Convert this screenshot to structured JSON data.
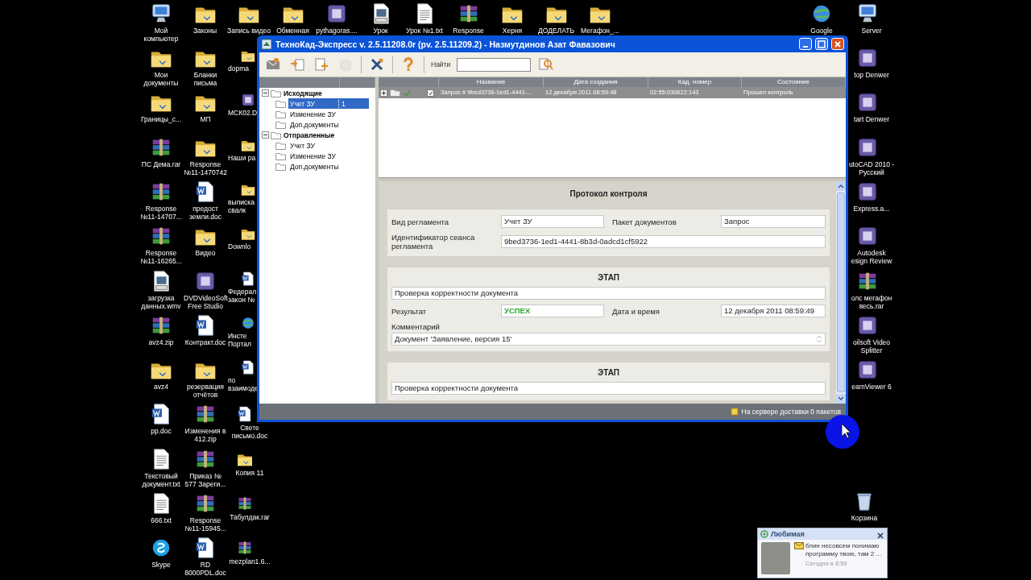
{
  "desktop": {
    "top_row": [
      {
        "label": "Мой компьютер",
        "kind": "computer"
      },
      {
        "label": "Законы",
        "kind": "folder"
      },
      {
        "label": "Запись видео",
        "kind": "folder"
      },
      {
        "label": "Обменная",
        "kind": "folder"
      },
      {
        "label": "pythagoras....",
        "kind": "app"
      },
      {
        "label": "Урок",
        "kind": "video"
      },
      {
        "label": "Урок №1.txt",
        "kind": "text"
      },
      {
        "label": "Response",
        "kind": "archive"
      },
      {
        "label": "Херня",
        "kind": "folder"
      },
      {
        "label": "ДОДЕЛАТЬ",
        "kind": "folder"
      },
      {
        "label": "Мегафон_...",
        "kind": "folder"
      }
    ],
    "column_1": [
      {
        "label": "Мои документы",
        "kind": "folder"
      },
      {
        "label": "Границы_с...",
        "kind": "folder"
      },
      {
        "label": "ПС Дема.rar",
        "kind": "archive"
      },
      {
        "label": "Response №11-14707...",
        "kind": "archive"
      },
      {
        "label": "Response №11-16265...",
        "kind": "archive"
      },
      {
        "label": "загрузка данных.wmv",
        "kind": "video"
      },
      {
        "label": "avz4.zip",
        "kind": "archive"
      },
      {
        "label": "avz4",
        "kind": "folder"
      },
      {
        "label": "pp.doc",
        "kind": "word"
      },
      {
        "label": "Текстовый документ.txt",
        "kind": "text"
      },
      {
        "label": "666.txt",
        "kind": "text"
      },
      {
        "label": "Skype",
        "kind": "chat"
      }
    ],
    "column_2": [
      {
        "label": "Бланки письма",
        "kind": "folder"
      },
      {
        "label": "МП",
        "kind": "folder"
      },
      {
        "label": "Response №11-1470742",
        "kind": "folder"
      },
      {
        "label": "предост земли.doc",
        "kind": "word"
      },
      {
        "label": "Видео",
        "kind": "folder"
      },
      {
        "label": "DVDVideoSoft Free Studio",
        "kind": "app"
      },
      {
        "label": "Контракт.doc",
        "kind": "word"
      },
      {
        "label": "резервация отчётов",
        "kind": "folder"
      },
      {
        "label": "Изменения в 412.zip",
        "kind": "archive"
      },
      {
        "label": "Приказ № 577 Зареги...",
        "kind": "archive"
      },
      {
        "label": "Response №11-15945...",
        "kind": "archive"
      },
      {
        "label": "RD 8000PDL.doc",
        "kind": "word"
      }
    ],
    "column_3": [
      {
        "label": "dopma",
        "kind": "folder"
      },
      {
        "label": "МСК02.D",
        "kind": "app"
      },
      {
        "label": "Наши ра",
        "kind": "folder"
      },
      {
        "label": "выписка свалк",
        "kind": "folder"
      },
      {
        "label": "Downlo",
        "kind": "folder"
      },
      {
        "label": "Федерал закон №",
        "kind": "word"
      },
      {
        "label": "Инсте Портал",
        "kind": "browser"
      },
      {
        "label": "по взаимоде",
        "kind": "word"
      },
      {
        "label": "Свете письмо.doc",
        "kind": "word"
      },
      {
        "label": "Копия 11",
        "kind": "folder"
      },
      {
        "label": "Табулдак.rar",
        "kind": "archive"
      },
      {
        "label": "mezplan1.6...",
        "kind": "archive"
      }
    ],
    "right_column_1": [
      {
        "label": "Google",
        "kind": "browser"
      }
    ],
    "right_column_2": [
      {
        "label": "Server",
        "kind": "computer"
      },
      {
        "label": "top Denwer",
        "kind": "app"
      },
      {
        "label": "tart Denwer",
        "kind": "app"
      },
      {
        "label": "utoCAD 2010 - Русский",
        "kind": "app"
      },
      {
        "label": "Express.a...",
        "kind": "app"
      },
      {
        "label": "Autodesk esign Review",
        "kind": "app"
      },
      {
        "label": "олс мегафон весь.rar",
        "kind": "archive"
      },
      {
        "label": "oilsoft Video Splitter",
        "kind": "app"
      },
      {
        "label": "eamViewer 6",
        "kind": "app"
      }
    ],
    "bottom_right": [
      {
        "label": "Корзина",
        "kind": "trash"
      }
    ]
  },
  "window": {
    "title": "ТехноКад-Экспресс v. 2.5.11208.0r (pv. 2.5.11209.2) - Назмутдинов Азат Фавазович",
    "toolbar": {
      "buttons": [
        {
          "kind": "envelope",
          "disabled": false
        },
        {
          "kind": "import",
          "disabled": false
        },
        {
          "kind": "add",
          "disabled": false
        },
        {
          "kind": "package",
          "disabled": true
        },
        {
          "kind": "tools",
          "disabled": false
        },
        {
          "kind": "help",
          "disabled": false
        }
      ],
      "search_label": "Найти"
    },
    "tree": [
      {
        "label": "Исходящие",
        "expanded": true,
        "children": [
          {
            "label": "Учет ЗУ",
            "count": "1",
            "selected": true
          },
          {
            "label": "Изменение ЗУ",
            "selected": false
          },
          {
            "label": "Доп.документы",
            "selected": false
          }
        ]
      },
      {
        "label": "Отправленные",
        "expanded": true,
        "children": [
          {
            "label": "Учет ЗУ",
            "selected": false
          },
          {
            "label": "Изменение ЗУ",
            "selected": false
          },
          {
            "label": "Доп.документы",
            "selected": false
          }
        ]
      }
    ],
    "table": {
      "columns": [
        "Название",
        "Дата создания",
        "Кад. номер",
        "Состояние"
      ],
      "rows": [
        {
          "expanded": false,
          "passed": true,
          "checked": true,
          "selected": true,
          "cells": [
            "Запрос # 9bed3736-1ed1-4441-...",
            "12 декабря 2011 08:59:48",
            "02:55:030622:143",
            "Прошел контроль"
          ]
        }
      ]
    },
    "protocol": {
      "title": "Протокол контроля",
      "fields": [
        {
          "label": "Вид регламента",
          "value": "Учет ЗУ"
        },
        {
          "label": "Пакет документов",
          "value": "Запрос"
        },
        {
          "label": "Идентификатор сеанса регламента",
          "value": "9bed3736-1ed1-4441-8b3d-0adcd1cf5922"
        }
      ],
      "stages": [
        {
          "title": "ЭТАП",
          "check": "Проверка корректности документа",
          "result_label": "Результат",
          "result": "УСПЕХ",
          "success": true,
          "date_label": "Дата и время",
          "date": "12 декабря 2011 08:59:49",
          "comment_label": "Комментарий",
          "comment": "Документ 'Заявление, версия 15'"
        },
        {
          "title": "ЭТАП",
          "check": "Проверка корректности документа"
        }
      ]
    },
    "status_bar": "На сервере доставки 0 пакетов"
  },
  "notification": {
    "title": "Любимая",
    "message": "блин несовсем понимаю программу твою, там 2 ...",
    "time": "Сегодня в 8:59"
  }
}
